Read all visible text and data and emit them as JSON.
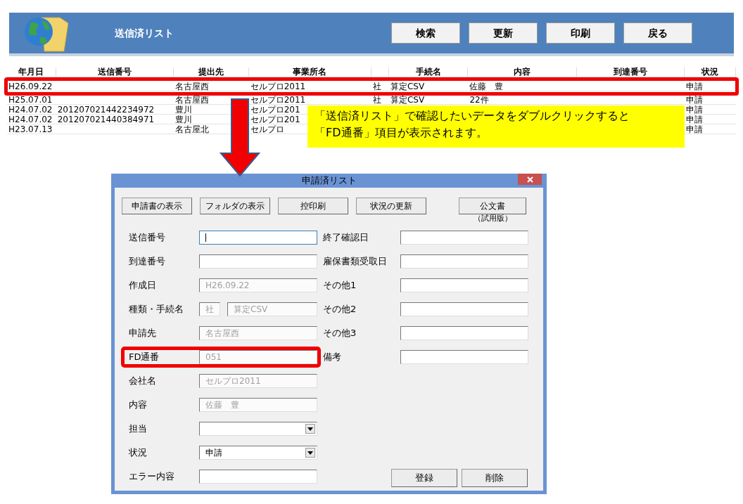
{
  "header": {
    "title": "送信済リスト",
    "buttons": [
      "検索",
      "更新",
      "印刷",
      "戻る"
    ]
  },
  "table": {
    "columns": [
      "年月日",
      "送信番号",
      "提出先",
      "事業所名",
      "",
      "手続名",
      "内容",
      "到達番号",
      "状況"
    ],
    "rows": [
      {
        "highlighted": true,
        "cells": [
          "H26.09.22",
          "",
          "名古屋西",
          "セルプロ2011",
          "社",
          "算定CSV",
          "佐藤　豊",
          "",
          "申請"
        ]
      },
      {
        "highlighted": false,
        "cells": [
          "H25.07.01",
          "",
          "名古屋西",
          "セルプロ2011",
          "社",
          "算定CSV",
          "22件",
          "",
          "申請"
        ]
      },
      {
        "highlighted": false,
        "cells": [
          "H24.07.02",
          "201207021442234972",
          "豊川",
          "セルプロ201",
          "",
          "",
          "",
          "",
          "申請"
        ]
      },
      {
        "highlighted": false,
        "cells": [
          "H24.07.02",
          "201207021440384971",
          "豊川",
          "セルプロ201",
          "",
          "",
          "",
          "",
          "申請"
        ]
      },
      {
        "highlighted": false,
        "cells": [
          "H23.07.13",
          "",
          "名古屋北",
          "セルプロ",
          "",
          "",
          "",
          "",
          "申請"
        ]
      }
    ]
  },
  "callout": {
    "lines": [
      "「送信済リスト」で確認したいデータをダブルクリックすると",
      "「FD通番」項目が表示されます。"
    ]
  },
  "dialog": {
    "title": "申請済リスト",
    "toolbar": [
      {
        "label": "申請書の表示"
      },
      {
        "label": "フォルダの表示"
      },
      {
        "label": "控印刷"
      },
      {
        "label": "状況の更新"
      },
      {
        "label": "公文書",
        "note": "（試用版）"
      }
    ],
    "left_fields": [
      {
        "label": "送信番号",
        "kind": "text",
        "disabled": false,
        "focused": true,
        "highlighted": false
      },
      {
        "label": "到達番号",
        "kind": "text",
        "disabled": false,
        "focused": false,
        "highlighted": false
      },
      {
        "label": "作成日",
        "kind": "text",
        "values": [
          "H26.09.22"
        ],
        "disabled": true,
        "focused": false,
        "highlighted": false
      },
      {
        "label": "種類・手続名",
        "kind": "pair",
        "values": [
          "社",
          "算定CSV"
        ],
        "disabled": true,
        "focused": false,
        "highlighted": false
      },
      {
        "label": "申請先",
        "kind": "text",
        "values": [
          "名古屋西"
        ],
        "disabled": true,
        "focused": false,
        "highlighted": false
      },
      {
        "label": "FD通番",
        "kind": "text",
        "values": [
          "051"
        ],
        "disabled": true,
        "focused": false,
        "highlighted": true
      },
      {
        "label": "会社名",
        "kind": "text",
        "values": [
          "セルプロ2011"
        ],
        "disabled": true,
        "focused": false,
        "highlighted": false
      },
      {
        "label": "内容",
        "kind": "text",
        "values": [
          "佐藤　豊"
        ],
        "disabled": true,
        "focused": false,
        "highlighted": false
      },
      {
        "label": "担当",
        "kind": "select",
        "disabled": false,
        "focused": false,
        "highlighted": false
      },
      {
        "label": "状況",
        "kind": "select",
        "values": [
          "申請"
        ],
        "disabled": false,
        "focused": false,
        "highlighted": false
      },
      {
        "label": "エラー内容",
        "kind": "text",
        "disabled": false,
        "focused": false,
        "highlighted": false
      }
    ],
    "right_fields": [
      {
        "label": "終了確認日"
      },
      {
        "label": "雇保書類受取日"
      },
      {
        "label": "その他1"
      },
      {
        "label": "その他2"
      },
      {
        "label": "その他3"
      },
      {
        "label": "備考"
      }
    ],
    "buttons": [
      "登録",
      "削除"
    ]
  }
}
